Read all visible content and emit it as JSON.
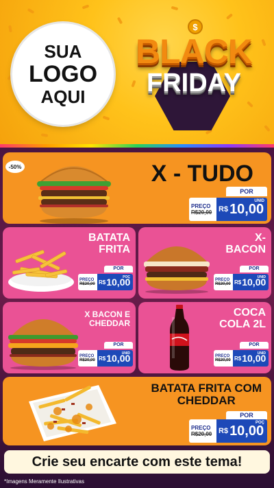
{
  "header": {
    "logo_line1": "SUA",
    "logo_line2": "LOGO",
    "logo_line3": "AQUI",
    "coin_symbol": "$",
    "black": "BLACK",
    "friday": "FRIDAY"
  },
  "badge": "-50%",
  "products": [
    {
      "title": "X - TUDO",
      "price_label": "PREÇO",
      "por": "POR",
      "old": "R$20,00",
      "currency": "R$",
      "price": "10,00",
      "unit": "UNID"
    },
    {
      "title_l1": "BATATA",
      "title_l2": "FRITA",
      "price_label": "PREÇO",
      "por": "POR",
      "old": "R$20,00",
      "currency": "R$",
      "price": "10,00",
      "unit": "POÇ"
    },
    {
      "title_l1": "X-",
      "title_l2": "BACON",
      "price_label": "PREÇO",
      "por": "POR",
      "old": "R$20,00",
      "currency": "R$",
      "price": "10,00",
      "unit": "UNID"
    },
    {
      "title_l1": "X BACON E",
      "title_l2": "CHEDDAR",
      "price_label": "PREÇO",
      "por": "POR",
      "old": "R$20,00",
      "currency": "R$",
      "price": "10,00",
      "unit": "UNID"
    },
    {
      "title_l1": "COCA",
      "title_l2": "COLA 2L",
      "price_label": "PREÇO",
      "por": "POR",
      "old": "R$20,00",
      "currency": "R$",
      "price": "10,00",
      "unit": "UNID"
    },
    {
      "title_l1": "BATATA FRITA COM",
      "title_l2": "CHEDDAR",
      "price_label": "PREÇO",
      "por": "POR",
      "old": "R$20,00",
      "currency": "R$",
      "price": "10,00",
      "unit": "POÇ"
    }
  ],
  "cta": "Crie seu encarte com este tema!",
  "disclaimer": "*Imagens Meramente Ilustrativas"
}
